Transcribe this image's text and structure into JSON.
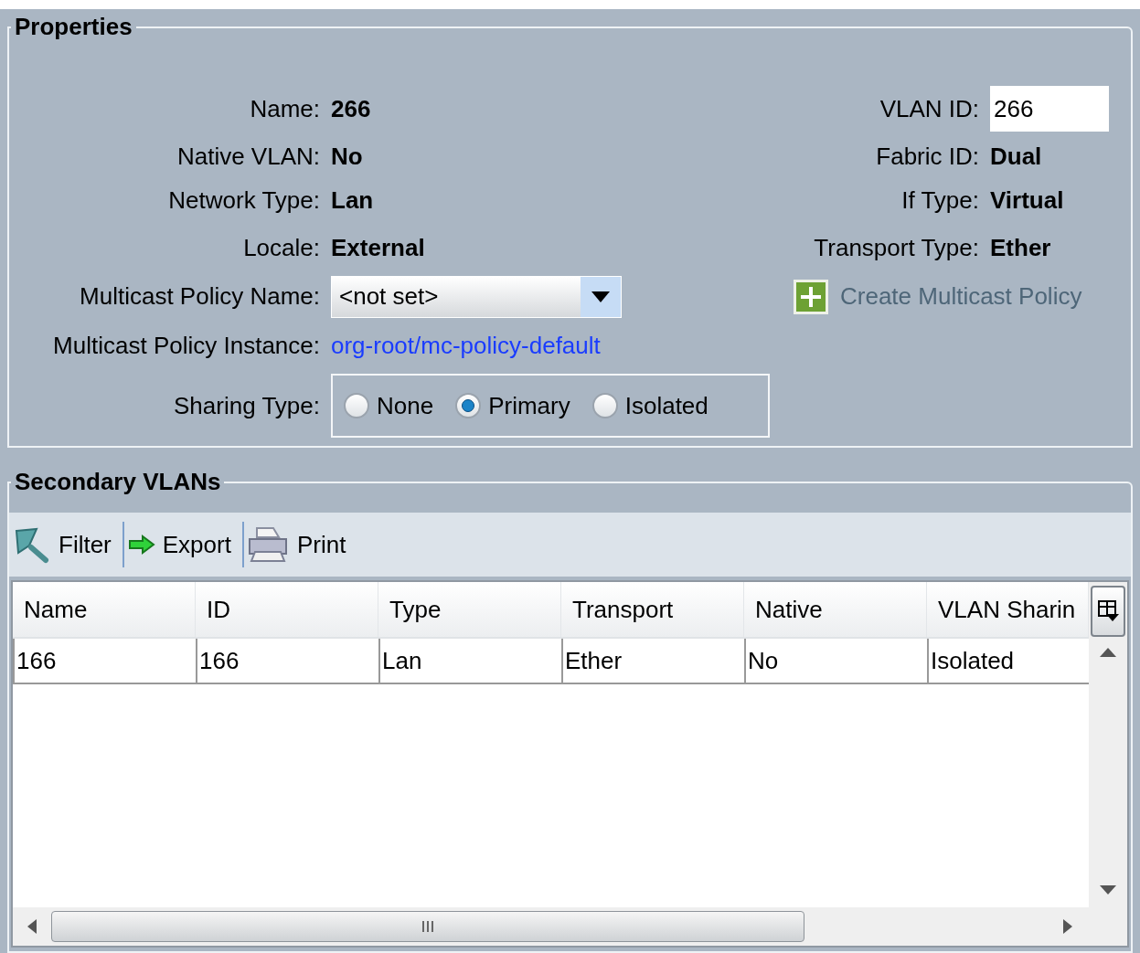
{
  "properties": {
    "title": "Properties",
    "left_fields": [
      {
        "label": "Name:",
        "kind": "bold",
        "value": "266"
      },
      {
        "label": "Native VLAN:",
        "kind": "bold",
        "value": "No"
      },
      {
        "label": "Network Type:",
        "kind": "bold",
        "value": "Lan"
      },
      {
        "label": "Locale:",
        "kind": "bold",
        "value": "External"
      },
      {
        "label": "Multicast Policy Name:",
        "kind": "dropdown",
        "value": "<not set>"
      },
      {
        "label": "Multicast Policy Instance:",
        "kind": "link",
        "value": "org-root/mc-policy-default"
      },
      {
        "label": "Sharing Type:",
        "kind": "radio",
        "options": [
          {
            "label": "None",
            "selected": false
          },
          {
            "label": "Primary",
            "selected": true
          },
          {
            "label": "Isolated",
            "selected": false
          }
        ]
      }
    ],
    "right_fields": [
      {
        "label": "VLAN ID:",
        "kind": "input",
        "value": "266"
      },
      {
        "label": "Fabric ID:",
        "kind": "bold",
        "value": "Dual"
      },
      {
        "label": "If Type:",
        "kind": "bold",
        "value": "Virtual"
      },
      {
        "label": "Transport Type:",
        "kind": "bold",
        "value": "Ether"
      },
      {
        "kind": "action",
        "value": "Create Multicast Policy"
      }
    ]
  },
  "secondary_vlans": {
    "title": "Secondary VLANs",
    "toolbar": [
      {
        "kind": "filter",
        "label": "Filter"
      },
      {
        "kind": "export",
        "label": "Export"
      },
      {
        "kind": "print",
        "label": "Print"
      }
    ],
    "table": {
      "columns": [
        "Name",
        "ID",
        "Type",
        "Transport",
        "Native",
        "VLAN Sharin"
      ],
      "rows": [
        [
          "166",
          "166",
          "Lan",
          "Ether",
          "No",
          "Isolated"
        ]
      ]
    }
  }
}
